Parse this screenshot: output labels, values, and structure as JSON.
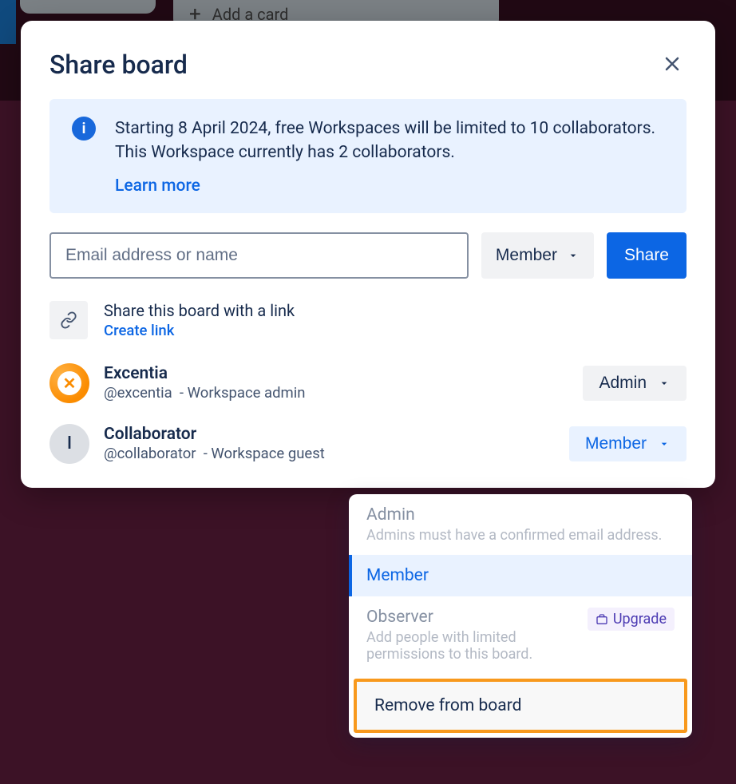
{
  "background": {
    "add_card": "Add a card"
  },
  "modal": {
    "title": "Share board",
    "banner": {
      "text": "Starting 8 April 2024, free Workspaces will be limited to 10 collaborators. This Workspace currently has 2 collaborators.",
      "learn_more": "Learn more"
    },
    "input_placeholder": "Email address or name",
    "role_default": "Member",
    "share_label": "Share",
    "link": {
      "title": "Share this board with a link",
      "create": "Create link"
    },
    "members": [
      {
        "name": "Excentia",
        "handle": "@excentia",
        "role_desc": "Workspace admin",
        "role": "Admin"
      },
      {
        "name": "Collaborator",
        "handle": "@collaborator",
        "role_desc": "Workspace guest",
        "role": "Member"
      }
    ]
  },
  "dropdown": {
    "admin": {
      "title": "Admin",
      "sub": "Admins must have a confirmed email address."
    },
    "member": {
      "title": "Member"
    },
    "observer": {
      "title": "Observer",
      "sub": "Add people with limited permissions to this board.",
      "upgrade": "Upgrade"
    },
    "remove": {
      "title": "Remove from board"
    }
  }
}
